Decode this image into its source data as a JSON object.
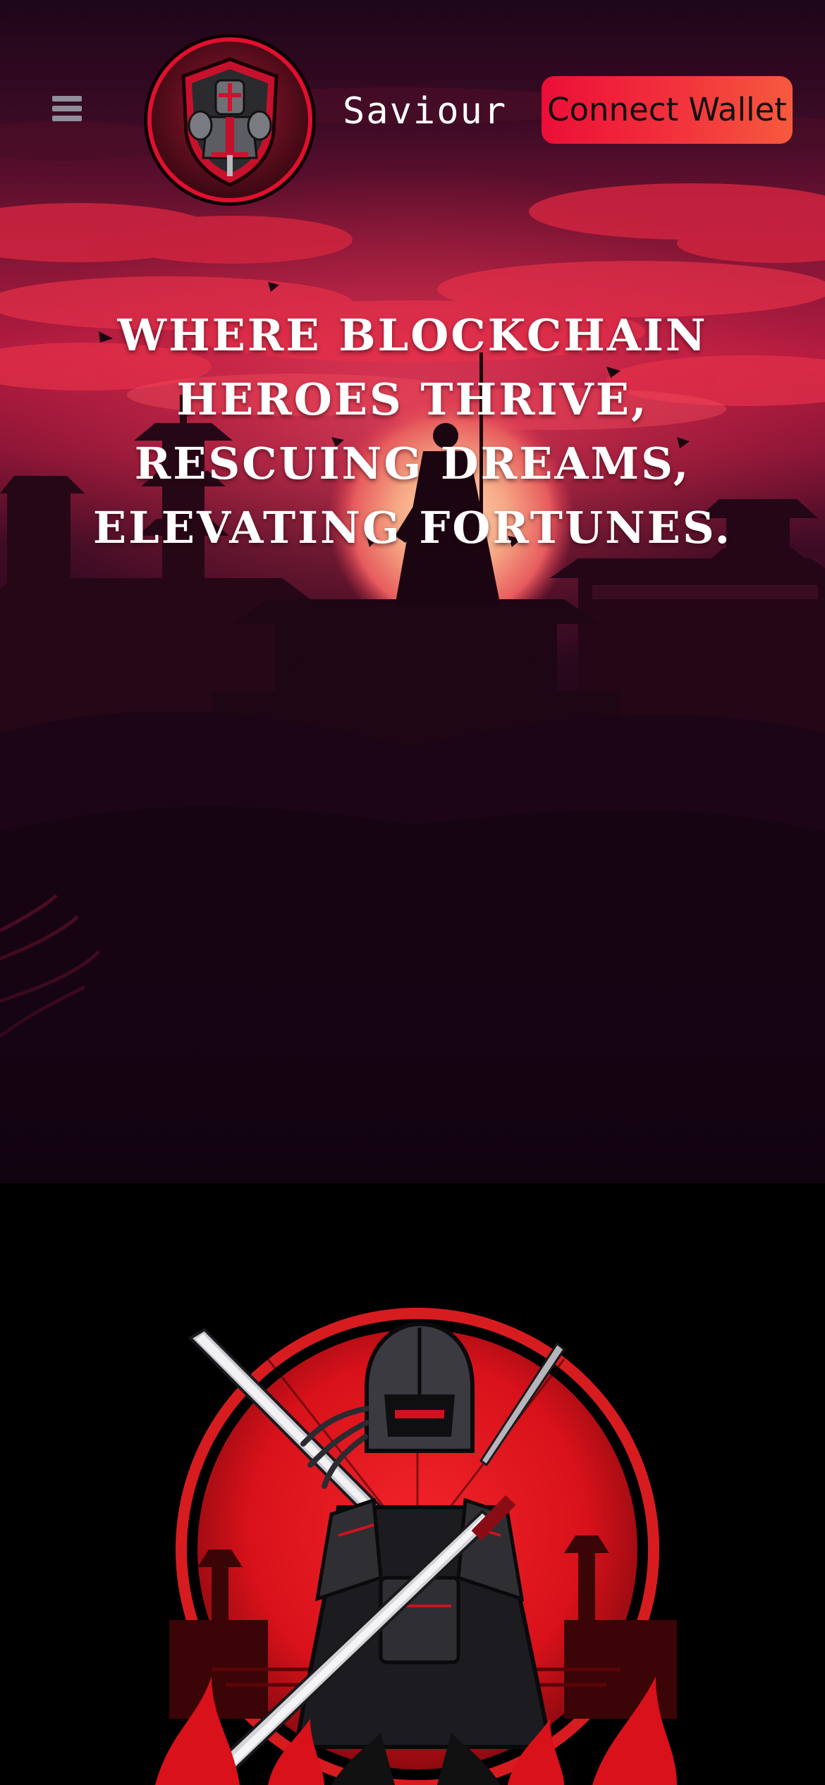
{
  "header": {
    "menu_icon": "hamburger-menu-icon",
    "logo_icon": "knight-shield-logo",
    "brand_name": "Saviour",
    "connect_label": "Connect Wallet"
  },
  "hero": {
    "headline": "Where Blockchain Heroes Thrive, Rescuing Dreams, Elevating Fortunes.",
    "background": "crimson-sunset-pagoda-samurai-scene"
  },
  "warrior": {
    "image": "samurai-knight-crossed-katanas-emblem"
  },
  "colors": {
    "background_dark": "#150514",
    "accent_red": "#ec0e37",
    "accent_orange": "#f65a3e",
    "text_white": "#ffffff",
    "menu_gray": "#8f8e9b"
  }
}
